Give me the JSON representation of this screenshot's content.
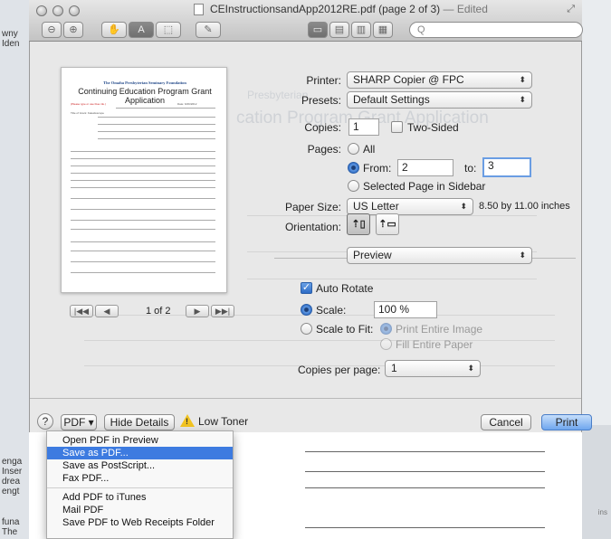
{
  "window": {
    "title": "CEInstructionsandApp2012RE.pdf (page 2 of 3)",
    "edited": "— Edited",
    "search_placeholder": "Q"
  },
  "background_left_text": [
    "wny",
    "Iden",
    "enga",
    "Inser",
    "drea",
    "engt",
    "funa",
    "The"
  ],
  "background_right_text": "ins",
  "preview": {
    "doc_title1": "The Omaha Presbyterian Seminary Foundation",
    "doc_title2": "Continuing Education Program Grant Application",
    "date_value": "6/26/2012",
    "name_value": "Kaleidoscope",
    "faded_heading1": "Presbyterian",
    "faded_heading2": "cation Program   Grant Application",
    "page_indicator": "1 of 2",
    "nav_first": "|◀◀",
    "nav_prev": "◀",
    "nav_next": "▶",
    "nav_last": "▶▶|"
  },
  "form": {
    "printer_label": "Printer:",
    "printer_value": "SHARP Copier @ FPC",
    "presets_label": "Presets:",
    "presets_value": "Default Settings",
    "copies_label": "Copies:",
    "copies_value": "1",
    "two_sided_label": "Two-Sided",
    "pages_label": "Pages:",
    "pages_all": "All",
    "pages_from": "From:",
    "pages_from_value": "2",
    "pages_to": "to:",
    "pages_to_value": "3",
    "pages_selected": "Selected Page in Sidebar",
    "paper_size_label": "Paper Size:",
    "paper_size_value": "US Letter",
    "paper_size_dims": "8.50 by 11.00 inches",
    "orientation_label": "Orientation:",
    "section_value": "Preview",
    "auto_rotate": "Auto Rotate",
    "scale_label": "Scale:",
    "scale_value": "100 %",
    "scale_to_fit_label": "Scale to Fit:",
    "print_entire_image": "Print Entire Image",
    "fill_entire_paper": "Fill Entire Paper",
    "copies_per_page_label": "Copies per page:",
    "copies_per_page_value": "1"
  },
  "bottom": {
    "help": "?",
    "pdf_button": "PDF ▾",
    "hide_details": "Hide Details",
    "low_toner": "Low Toner",
    "cancel": "Cancel",
    "print": "Print"
  },
  "pdf_menu": {
    "items": [
      "Open PDF in Preview",
      "Save as PDF...",
      "Save as PostScript...",
      "Fax PDF...",
      "Add PDF to iTunes",
      "Mail PDF",
      "Save PDF to Web Receipts Folder"
    ],
    "highlighted_index": 1
  },
  "colors": {
    "accent": "#3d7be0",
    "warning": "#f2c421"
  }
}
